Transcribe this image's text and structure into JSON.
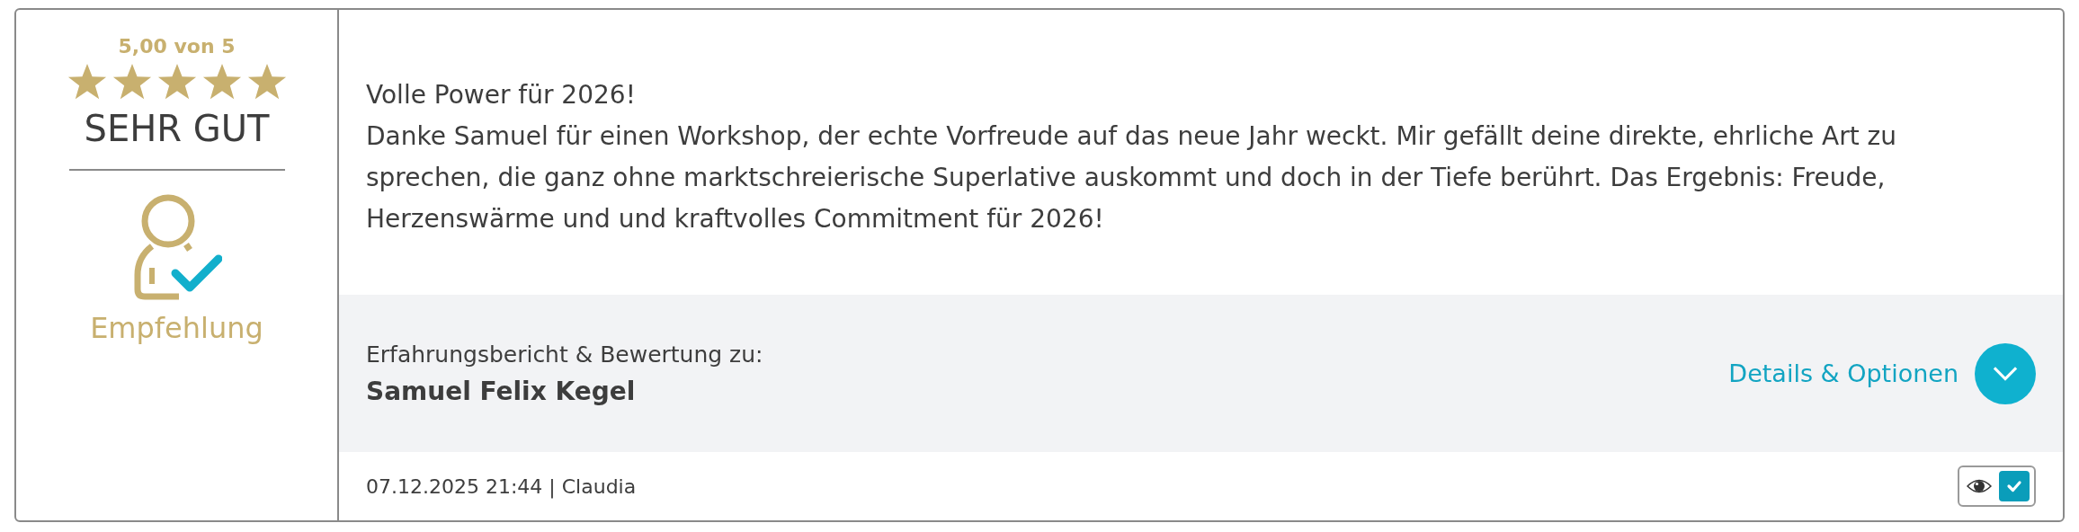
{
  "rating": {
    "score": "5,00 von 5",
    "stars": 5,
    "verdict": "SEHR GUT"
  },
  "badge": {
    "label": "Empfehlung"
  },
  "review": {
    "title": "Volle Power für 2026!",
    "text": "Danke Samuel für einen Workshop, der echte Vorfreude auf das neue Jahr weckt. Mir gefällt deine direkte, ehrliche Art zu sprechen, die ganz ohne marktschreierische Superlative auskommt und doch in der Tiefe berührt. Das Ergebnis: Freude, Herzenswärme und und kraftvolles Commitment für 2026!"
  },
  "subject": {
    "label": "Erfahrungsbericht & Bewertung zu:",
    "name": "Samuel Felix Kegel"
  },
  "details_button": {
    "label": "Details & Optionen",
    "expanded": false
  },
  "footer": {
    "meta": "07.12.2025 21:44 | Claudia",
    "approved": {
      "checked": true
    }
  }
}
